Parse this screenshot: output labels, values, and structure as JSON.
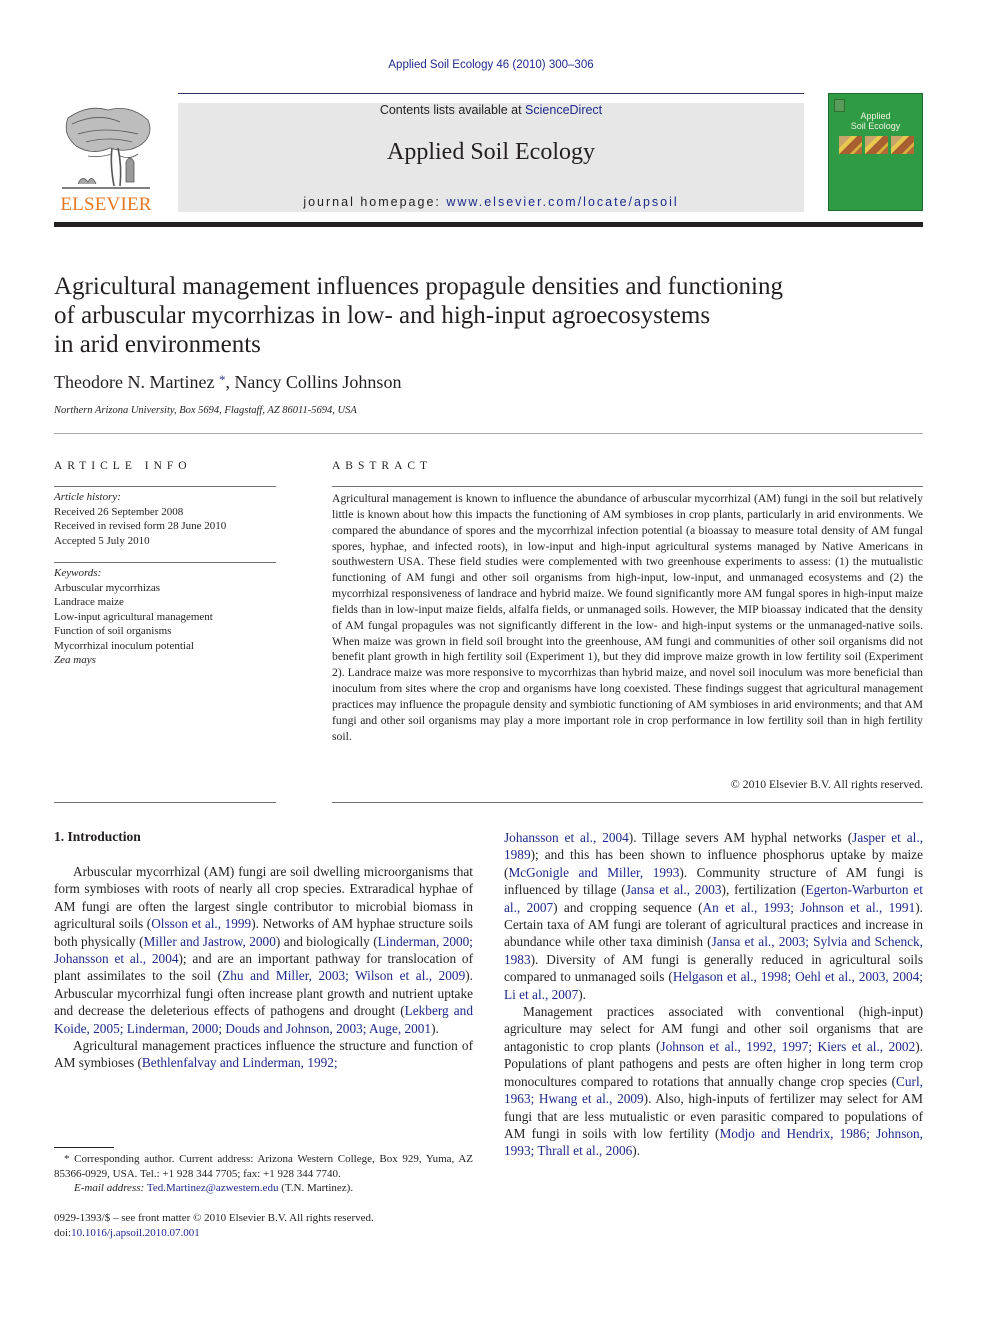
{
  "header": {
    "citation": "Applied Soil Ecology 46 (2010) 300–306",
    "contents_prefix": "Contents lists available at ",
    "contents_link": "ScienceDirect",
    "journal_name": "Applied Soil Ecology",
    "homepage_prefix": "journal homepage: ",
    "homepage_link": "www.elsevier.com/locate/apsoil",
    "publisher_logo_text": "ELSEVIER",
    "cover_title_line1": "Applied",
    "cover_title_line2": "Soil Ecology",
    "colors": {
      "link": "#1f2a8a",
      "elsevier_orange": "#e87722",
      "cover_green": "#2f9b45",
      "masthead_gray": "#e7e7e8"
    }
  },
  "article": {
    "title": "Agricultural management influences propagule densities and functioning of arbuscular mycorrhizas in low- and high-input agroecosystems in arid environments",
    "title_lines": [
      "Agricultural management influences propagule densities and functioning",
      "of arbuscular mycorrhizas in low- and high-input agroecosystems",
      "in arid environments"
    ],
    "author1": "Theodore N. Martinez",
    "author_mark": "*",
    "author_sep": ", ",
    "author2": "Nancy Collins Johnson",
    "affiliation": "Northern Arizona University, Box 5694, Flagstaff, AZ 86011-5694, USA"
  },
  "article_info": {
    "label": "ARTICLE INFO",
    "history_label": "Article history:",
    "history": [
      "Received 26 September 2008",
      "Received in revised form 28 June 2010",
      "Accepted 5 July 2010"
    ],
    "keywords_label": "Keywords:",
    "keywords": [
      "Arbuscular mycorrhizas",
      "Landrace maize",
      "Low-input agricultural management",
      "Function of soil organisms",
      "Mycorrhizal inoculum potential",
      "Zea mays"
    ]
  },
  "abstract": {
    "label": "ABSTRACT",
    "text": "Agricultural management is known to influence the abundance of arbuscular mycorrhizal (AM) fungi in the soil but relatively little is known about how this impacts the functioning of AM symbioses in crop plants, particularly in arid environments. We compared the abundance of spores and the mycorrhizal infection potential (a bioassay to measure total density of AM fungal spores, hyphae, and infected roots), in low-input and high-input agricultural systems managed by Native Americans in southwestern USA. These field studies were complemented with two greenhouse experiments to assess: (1) the mutualistic functioning of AM fungi and other soil organisms from high-input, low-input, and unmanaged ecosystems and (2) the mycorrhizal responsiveness of landrace and hybrid maize. We found significantly more AM fungal spores in high-input maize fields than in low-input maize fields, alfalfa fields, or unmanaged soils. However, the MIP bioassay indicated that the density of AM fungal propagules was not significantly dif­ferent in the low- and high-input systems or the unmanaged-native soils. When maize was grown in field soil brought into the greenhouse, AM fungi and communities of other soil organisms did not benefit plant growth in high fertility soil (Experiment 1), but they did improve maize growth in low fertility soil (Exper­iment 2). Landrace maize was more responsive to mycorrhizas than hybrid maize, and novel soil inoculum was more beneficial than inoculum from sites where the crop and organisms have long coexisted. These findings suggest that agricultural management practices may influence the propagule density and sym­biotic functioning of AM symbioses in arid environments; and that AM fungi and other soil organisms may play a more important role in crop performance in low fertility soil than in high fertility soil.",
    "copyright": "© 2010 Elsevier B.V. All rights reserved."
  },
  "intro": {
    "heading": "1.  Introduction",
    "p1": [
      {
        "t": "Arbuscular mycorrhizal (AM) fungi are soil dwelling microor­ganisms that form symbioses with roots of nearly all crop species. Extraradical hyphae of AM fungi are often the largest single contrib­utor to microbial biomass in agricultural soils ("
      },
      {
        "c": "Olsson et al., 1999"
      },
      {
        "t": "). Networks of AM hyphae structure soils both physically ("
      },
      {
        "c": "Miller and Jastrow, 2000"
      },
      {
        "t": ") and biologically ("
      },
      {
        "c": "Linderman, 2000; Johansson et al., 2004"
      },
      {
        "t": "); and are an important pathway for translocation of plant assimilates to the soil ("
      },
      {
        "c": "Zhu and Miller, 2003; Wilson et al., 2009"
      },
      {
        "t": "). Arbuscular mycorrhizal fungi often increase plant growth and nutrient uptake and decrease the deleterious effects of pathogens and drought ("
      },
      {
        "c": "Lekberg and Koide, 2005; Linderman, 2000; Douds and Johnson, 2003; Auge, 2001"
      },
      {
        "t": ")."
      }
    ],
    "p2": [
      {
        "t": "Agricultural management practices influence the structure and function of AM symbioses ("
      },
      {
        "c": "Bethlenfalvay and Linderman, 1992;"
      }
    ],
    "p2_cont": [
      {
        "c": "Johansson et al., 2004"
      },
      {
        "t": "). Tillage severs AM hyphal networks ("
      },
      {
        "c": "Jasper et al., 1989"
      },
      {
        "t": "); and this has been shown to influence phosphorus uptake by maize ("
      },
      {
        "c": "McGonigle and Miller, 1993"
      },
      {
        "t": "). Community structure of AM fungi is influenced by tillage ("
      },
      {
        "c": "Jansa et al., 2003"
      },
      {
        "t": "), fertilization ("
      },
      {
        "c": "Egerton-Warburton et al., 2007"
      },
      {
        "t": ") and cropping sequence ("
      },
      {
        "c": "An et al., 1993; Johnson et al., 1991"
      },
      {
        "t": "). Certain taxa of AM fungi are tolerant of agricultural practices and increase in abundance while other taxa diminish ("
      },
      {
        "c": "Jansa et al., 2003; Sylvia and Schenck, 1983"
      },
      {
        "t": "). Diversity of AM fungi is generally reduced in agricultural soils compared to unmanaged soils ("
      },
      {
        "c": "Helgason et al., 1998; Oehl et al., 2003, 2004; Li et al., 2007"
      },
      {
        "t": ")."
      }
    ],
    "p3": [
      {
        "t": "Management practices associated with conventional (high-input) agriculture may select for AM fungi and other soil organisms that are antagonistic to crop plants ("
      },
      {
        "c": "Johnson et al., 1992, 1997; Kiers et al., 2002"
      },
      {
        "t": "). Populations of plant pathogens and pests are often higher in long term crop monocultures compared to rotations that annually change crop species ("
      },
      {
        "c": "Curl, 1963; Hwang et al., 2009"
      },
      {
        "t": "). Also, high-inputs of fertilizer may select for AM fungi that are less mutu­alistic or even parasitic compared to populations of AM fungi in soils with low fertility ("
      },
      {
        "c": "Modjo and Hendrix, 1986; Johnson, 1993; Thrall et al., 2006"
      },
      {
        "t": ")."
      }
    ]
  },
  "footnote": {
    "mark": "*",
    "text": " Corresponding author. Current address: Arizona Western College, Box 929, Yuma, AZ 85366-0929, USA. Tel.: +1 928 344 7705; fax: +1 928 344 7740.",
    "email_label": "E-mail address: ",
    "email": "Ted.Martinez@azwestern.edu",
    "email_suffix": " (T.N. Martinez)."
  },
  "front_matter": {
    "issn_line": "0929-1393/$ – see front matter © 2010 Elsevier B.V. All rights reserved.",
    "doi_prefix": "doi:",
    "doi": "10.1016/j.apsoil.2010.07.001"
  }
}
